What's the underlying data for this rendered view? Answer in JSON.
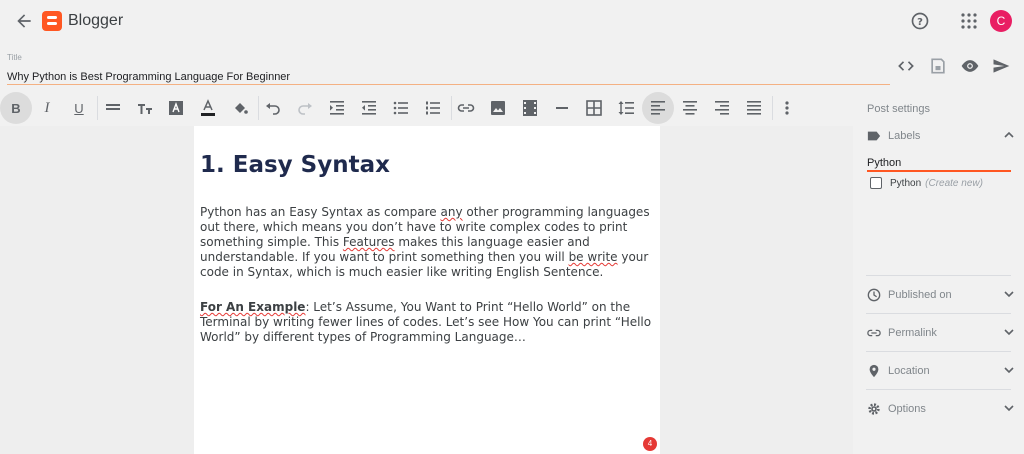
{
  "app": {
    "name": "Blogger",
    "avatar_initial": "C",
    "brand_color": "#ff5722",
    "avatar_color": "#e91e63"
  },
  "title": {
    "caption": "Title",
    "value": "Why Python is Best Programming Language For Beginner"
  },
  "editor": {
    "heading": "1. Easy Syntax",
    "p1_parts": [
      "Python has an Easy Syntax as compare ",
      "any",
      " other programming languages out there, which means you don’t have to write complex codes to print something simple. This ",
      "Features",
      " makes this language easier and understandable. If you want to print something then you will ",
      "be write",
      " your code in Syntax, which is much easier like writing English Sentence."
    ],
    "p2_bold": "For An Example",
    "p2_rest": ": Let’s Assume, You Want to Print “Hello World” on the Terminal by writing fewer lines of codes. Let’s see How You can print “Hello World” by different types of Programming Language…",
    "badge_count": "4"
  },
  "sidebar": {
    "title": "Post settings",
    "labels": {
      "heading": "Labels",
      "input_value": "Python",
      "suggestion": "Python",
      "suggestion_hint": "(Create new)"
    },
    "sections": [
      "Published on",
      "Permalink",
      "Location",
      "Options"
    ]
  }
}
